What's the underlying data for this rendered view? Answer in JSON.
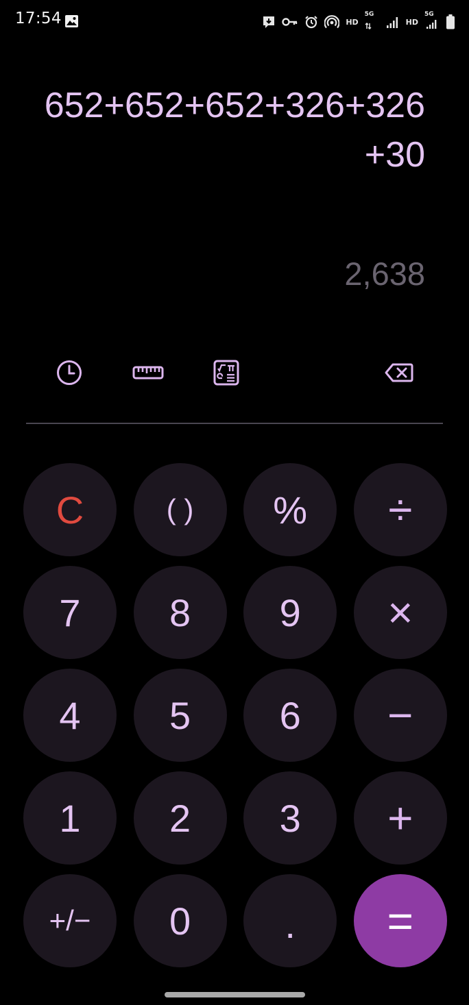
{
  "status_bar": {
    "time": "17:54",
    "hd_label_1": "HD",
    "hd_label_2": "HD",
    "network_1": "5G",
    "network_2": "5G"
  },
  "display": {
    "expression": "652+652+652+326+326+30",
    "result": "2,638"
  },
  "toolbar": {
    "icons": [
      "history-icon",
      "ruler-icon",
      "scientific-icon",
      "backspace-icon"
    ]
  },
  "keypad": {
    "rows": [
      [
        "C",
        "( )",
        "%",
        "÷"
      ],
      [
        "7",
        "8",
        "9",
        "×"
      ],
      [
        "4",
        "5",
        "6",
        "−"
      ],
      [
        "1",
        "2",
        "3",
        "+"
      ],
      [
        "+/−",
        "0",
        ".",
        "="
      ]
    ]
  },
  "colors": {
    "background": "#000000",
    "expression": "#e4c4f2",
    "result": "#6a6470",
    "key_background": "#1c161f",
    "clear": "#e04a3f",
    "equals_background": "#8e3ba4"
  }
}
